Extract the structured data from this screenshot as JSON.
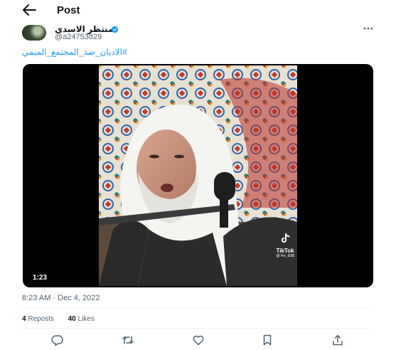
{
  "header": {
    "back_icon": "arrow-left-icon",
    "title": "Post"
  },
  "post": {
    "author": {
      "display_name": "منتظر الاسدي",
      "handle": "@a24753829",
      "verified": true
    },
    "more_icon": "more-horizontal-icon",
    "text": "#الاديان_ضد_المجتمع_الميمي",
    "media": {
      "type": "video",
      "duration": "1:23",
      "watermark": {
        "name": "TikTok",
        "user": "@ fro_838"
      }
    },
    "timestamp": "8:23 AM · Dec 4, 2022",
    "stats": {
      "reposts_count": "4",
      "reposts_label": "Reposts",
      "likes_count": "40",
      "likes_label": "Likes"
    },
    "actions": [
      "reply-icon",
      "repost-icon",
      "like-icon",
      "bookmark-icon",
      "share-icon"
    ]
  },
  "colors": {
    "accent": "#1d9bf0",
    "text_primary": "#0f1419",
    "text_secondary": "#536471",
    "divider": "#eff3f4"
  }
}
